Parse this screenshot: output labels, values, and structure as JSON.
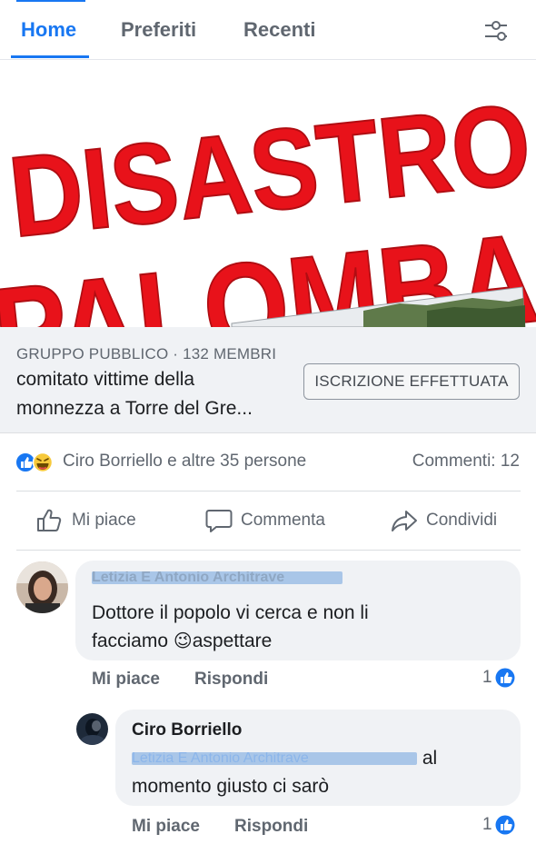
{
  "tabs": [
    {
      "label": "Home",
      "active": true
    },
    {
      "label": "Preferiti",
      "active": false
    },
    {
      "label": "Recenti",
      "active": false
    }
  ],
  "filter_icon": "sliders-icon",
  "banner": {
    "line1": "DISASTRO",
    "line2": "PALOMBA",
    "text_color": "#e8121a"
  },
  "group": {
    "meta": "GRUPPO PUBBLICO · 132 MEMBRI",
    "name_line1": "comitato vittime della",
    "name_line2": "monnezza a Torre del Gre...",
    "join_label": "ISCRIZIONE EFFETTUATA"
  },
  "reactions": {
    "icons": [
      "like-reaction-icon",
      "haha-reaction-icon"
    ],
    "summary": "Ciro Borriello e altre 35 persone",
    "comments": "Commenti: 12"
  },
  "actions": {
    "like": "Mi piace",
    "comment": "Commenta",
    "share": "Condividi"
  },
  "comments": [
    {
      "author": "Letizia E Antonio Architrave",
      "text_line1": "Dottore il popolo vi cerca e non li",
      "text_line2_before": "facciamo ",
      "emoji": "😉",
      "text_line2_after": "aspettare",
      "like_label": "Mi piace",
      "reply_label": "Rispondi",
      "likes": "1"
    },
    {
      "author": "Ciro Borriello",
      "mention": "Letizia E Antonio Architrave",
      "text_line1_after": " al",
      "text_line2": "momento giusto ci sarò",
      "like_label": "Mi piace",
      "reply_label": "Rispondi",
      "likes": "1"
    }
  ],
  "colors": {
    "accent": "#1877f2",
    "secondary_text": "#606770",
    "bubble": "#f0f2f5"
  }
}
